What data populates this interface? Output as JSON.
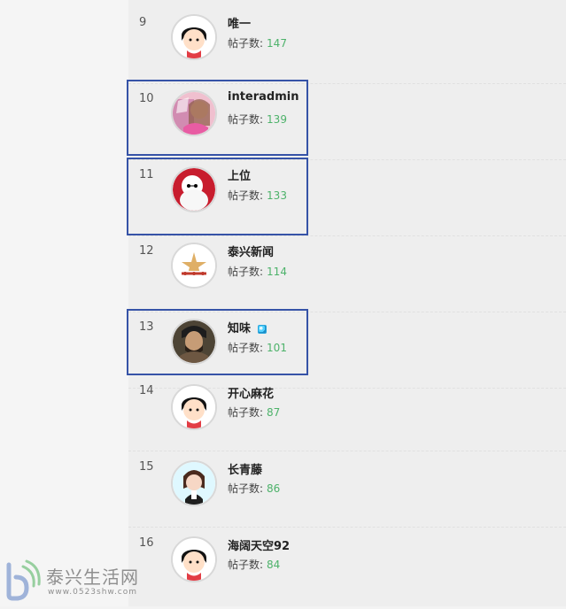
{
  "rankings": [
    {
      "rank": "9",
      "name": "唯一",
      "posts_label": "帖子数:",
      "posts": "147"
    },
    {
      "rank": "10",
      "name": "interadmin",
      "posts_label": "帖子数:",
      "posts": "139"
    },
    {
      "rank": "11",
      "name": "上位",
      "posts_label": "帖子数:",
      "posts": "133"
    },
    {
      "rank": "12",
      "name": "泰兴新闻",
      "posts_label": "帖子数:",
      "posts": "114"
    },
    {
      "rank": "13",
      "name": "知味",
      "posts_label": "帖子数:",
      "posts": "101"
    },
    {
      "rank": "14",
      "name": "开心麻花",
      "posts_label": "帖子数:",
      "posts": "87"
    },
    {
      "rank": "15",
      "name": "长青藤",
      "posts_label": "帖子数:",
      "posts": "86"
    },
    {
      "rank": "16",
      "name": "海阔天空92",
      "posts_label": "帖子数:",
      "posts": "84"
    }
  ],
  "watermark": {
    "title": "泰兴生活网",
    "url": "www.0523shw.com"
  },
  "colors": {
    "highlight_border": "#3653a7",
    "post_count": "#4db26a"
  },
  "icons": {
    "badge": "cyan-gem-icon"
  }
}
